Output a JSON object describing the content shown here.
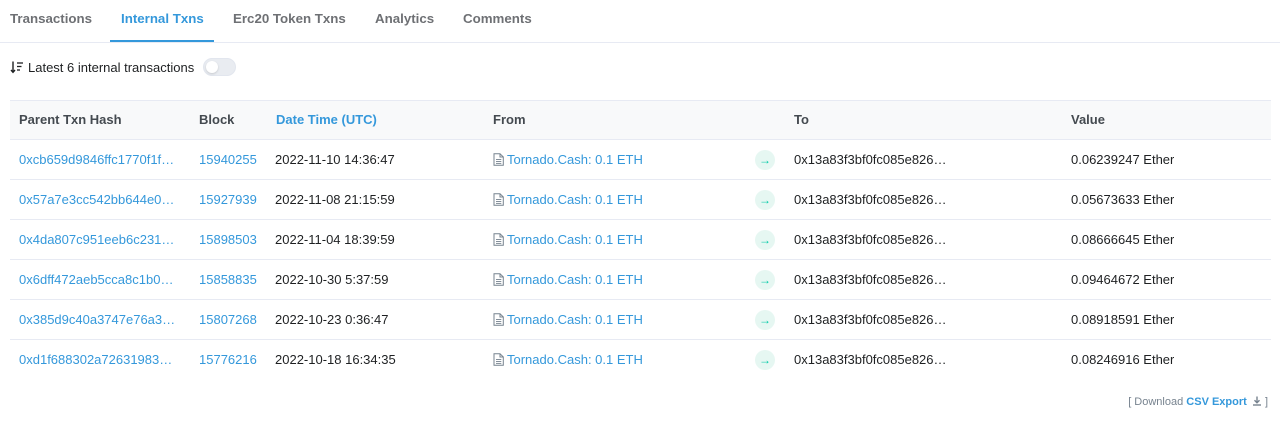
{
  "tabs": [
    {
      "label": "Transactions",
      "active": false
    },
    {
      "label": "Internal Txns",
      "active": true
    },
    {
      "label": "Erc20 Token Txns",
      "active": false
    },
    {
      "label": "Analytics",
      "active": false
    },
    {
      "label": "Comments",
      "active": false
    }
  ],
  "summary": {
    "text": "Latest 6 internal transactions",
    "toggle_on": false
  },
  "table": {
    "headers": {
      "hash": "Parent Txn Hash",
      "block": "Block",
      "date": "Date Time (UTC)",
      "from": "From",
      "to": "To",
      "value": "Value"
    },
    "rows": [
      {
        "hash": "0xcb659d9846ffc1770f1f…",
        "block": "15940255",
        "date": "2022-11-10 14:36:47",
        "from": "Tornado.Cash: 0.1 ETH",
        "arrow": "→",
        "to": "0x13a83f3bf0fc085e826…",
        "value": "0.06239247 Ether"
      },
      {
        "hash": "0x57a7e3cc542bb644e0…",
        "block": "15927939",
        "date": "2022-11-08 21:15:59",
        "from": "Tornado.Cash: 0.1 ETH",
        "arrow": "→",
        "to": "0x13a83f3bf0fc085e826…",
        "value": "0.05673633 Ether"
      },
      {
        "hash": "0x4da807c951eeb6c231…",
        "block": "15898503",
        "date": "2022-11-04 18:39:59",
        "from": "Tornado.Cash: 0.1 ETH",
        "arrow": "→",
        "to": "0x13a83f3bf0fc085e826…",
        "value": "0.08666645 Ether"
      },
      {
        "hash": "0x6dff472aeb5cca8c1b0…",
        "block": "15858835",
        "date": "2022-10-30 5:37:59",
        "from": "Tornado.Cash: 0.1 ETH",
        "arrow": "→",
        "to": "0x13a83f3bf0fc085e826…",
        "value": "0.09464672 Ether"
      },
      {
        "hash": "0x385d9c40a3747e76a3…",
        "block": "15807268",
        "date": "2022-10-23 0:36:47",
        "from": "Tornado.Cash: 0.1 ETH",
        "arrow": "→",
        "to": "0x13a83f3bf0fc085e826…",
        "value": "0.08918591 Ether"
      },
      {
        "hash": "0xd1f688302a72631983…",
        "block": "15776216",
        "date": "2022-10-18 16:34:35",
        "from": "Tornado.Cash: 0.1 ETH",
        "arrow": "→",
        "to": "0x13a83f3bf0fc085e826…",
        "value": "0.08246916 Ether"
      }
    ]
  },
  "footer": {
    "open": "[ Download",
    "link": "CSV Export",
    "close": "]"
  },
  "colors": {
    "accent": "#3498db",
    "arrow_green": "#00c9a7",
    "text": "#1e2022",
    "muted": "#6e7074"
  }
}
